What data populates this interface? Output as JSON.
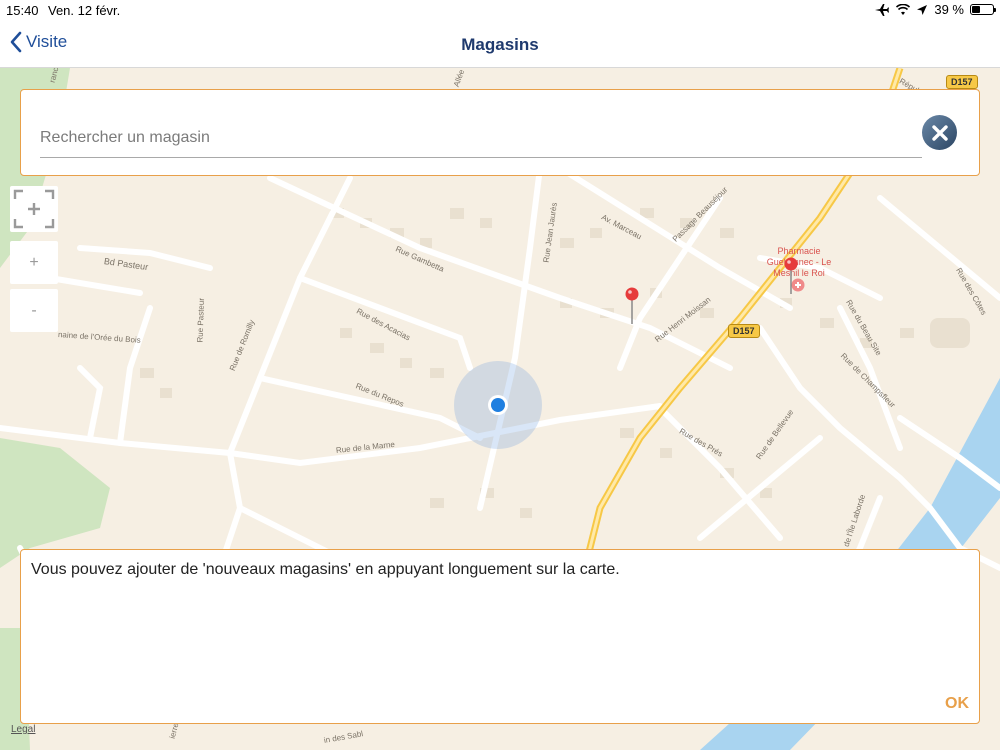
{
  "status_bar": {
    "time": "15:40",
    "date": "Ven. 12 févr.",
    "battery": "39 %",
    "battery_level": 0.39
  },
  "nav": {
    "back_label": "Visite",
    "title": "Magasins"
  },
  "search": {
    "placeholder": "Rechercher un magasin",
    "value": ""
  },
  "map_controls": {
    "zoom_in": "+",
    "zoom_out": "-"
  },
  "map": {
    "streets": {
      "rue_gambetta": "Rue Gambetta",
      "bd_pasteur": "Bd Pasteur",
      "rue_des_acacias": "Rue des Acacias",
      "rue_du_repos": "Rue du Repos",
      "rue_de_la_marne": "Rue de la Marne",
      "rue_pasteur": "Rue Pasteur",
      "rue_de_romilly": "Rue de Romilly",
      "rue_jean_jaures": "Rue Jean Jaurès",
      "av_marceau": "Av. Marceau",
      "passage_beausejour": "Passage Beauséjour",
      "rue_henri_moissan": "Rue Henri Moissan",
      "rue_des_pres": "Rue des Prés",
      "rue_de_bellevue": "Rue de Bellevue",
      "rue_de_champsfleur": "Rue de Champsfleur",
      "rue_du_beau_site": "Rue du Beau Site",
      "rue_des_cotes": "Rue des Côtes",
      "rue_de_lile_laborde": "de l'Île Laborde",
      "domaine_oree_du_bois": "naine de l'Orée du Bois",
      "allee": "Allée",
      "republique": "Républi",
      "france": "rance",
      "sablons": "in des Sabl",
      "pierre": "ierre"
    },
    "road_badge": "D157",
    "poi": "Pharmacie Guehennec - Le Mesnil le Roi"
  },
  "info": {
    "message": "Vous pouvez ajouter de 'nouveaux magasins' en appuyant longuement sur la carte.",
    "ok_label": "OK"
  },
  "legal": "Legal",
  "colors": {
    "accent": "#e8a04a",
    "nav_blue": "#1f4e99",
    "map_bg": "#f6efe3",
    "river": "#a9d4f0",
    "park": "#cfe5c0",
    "highway": "#f7c846",
    "location": "#1f7fe0",
    "pin": "#e63b3b"
  }
}
